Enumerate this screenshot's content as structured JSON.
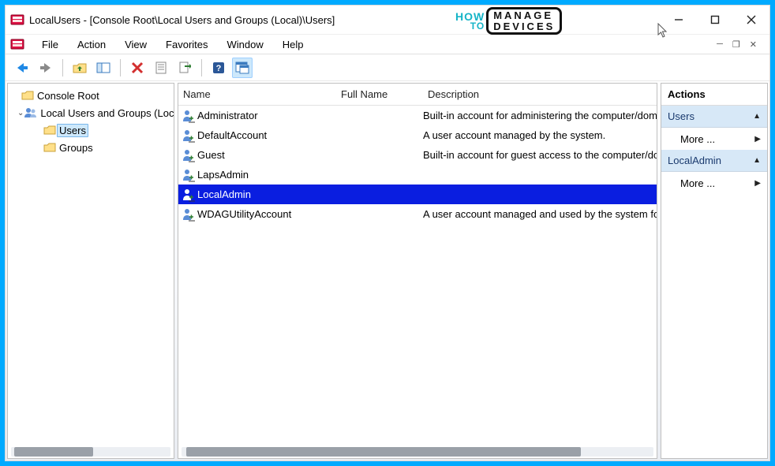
{
  "titlebar": {
    "title": "LocalUsers - [Console Root\\Local Users and Groups (Local)\\Users]"
  },
  "watermark": {
    "how": "HOW",
    "to": "TO",
    "line1": "MANAGE",
    "line2": "DEVICES"
  },
  "menu": {
    "file": "File",
    "action": "Action",
    "view": "View",
    "favorites": "Favorites",
    "window": "Window",
    "help": "Help"
  },
  "tree": {
    "root": "Console Root",
    "lug": "Local Users and Groups (Local)",
    "users": "Users",
    "groups": "Groups"
  },
  "list": {
    "headers": {
      "name": "Name",
      "fullname": "Full Name",
      "description": "Description"
    },
    "rows": [
      {
        "name": "Administrator",
        "fullname": "",
        "description": "Built-in account for administering the computer/domain",
        "selected": false
      },
      {
        "name": "DefaultAccount",
        "fullname": "",
        "description": "A user account managed by the system.",
        "selected": false
      },
      {
        "name": "Guest",
        "fullname": "",
        "description": "Built-in account for guest access to the computer/domain",
        "selected": false
      },
      {
        "name": "LapsAdmin",
        "fullname": "",
        "description": "",
        "selected": false
      },
      {
        "name": "LocalAdmin",
        "fullname": "",
        "description": "",
        "selected": true
      },
      {
        "name": "WDAGUtilityAccount",
        "fullname": "",
        "description": "A user account managed and used by the system for Windows Defender Application Guard",
        "selected": false
      }
    ]
  },
  "actions": {
    "header": "Actions",
    "group1": "Users",
    "more": "More ...",
    "group2": "LocalAdmin"
  }
}
